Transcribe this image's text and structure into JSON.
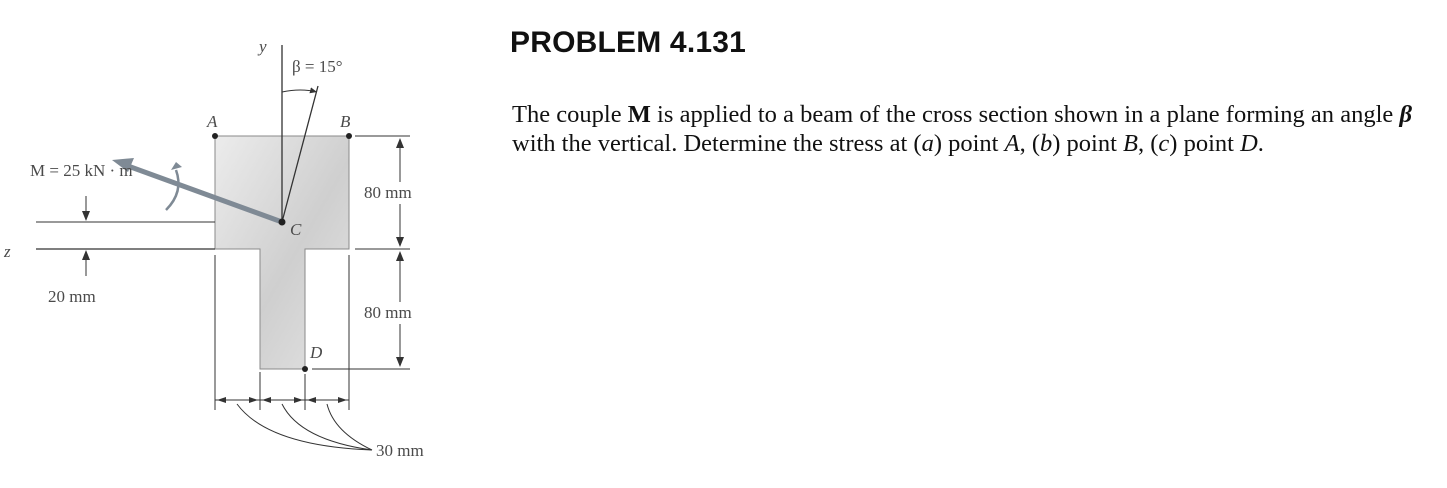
{
  "problem": {
    "title": "PROBLEM 4.131",
    "statement": {
      "p1": "The couple ",
      "M": "M",
      "p2": " is applied to a beam of the cross section shown in a plane forming an angle ",
      "beta": "β",
      "p3": " with the vertical. Determine the stress at (",
      "a": "a",
      "p4": ") point ",
      "A": "A",
      "p5": ", (",
      "b": "b",
      "p6": ") point ",
      "B": "B",
      "p7": ", (",
      "c": "c",
      "p8": ") point ",
      "D": "D",
      "p9": "."
    }
  },
  "figure": {
    "moment_label": "M = 25 kN · m",
    "beta_label": "β = 15°",
    "axis_y": "y",
    "axis_z": "z",
    "point_A": "A",
    "point_B": "B",
    "point_C": "C",
    "point_D": "D",
    "dim_80_top": "80 mm",
    "dim_80_bottom": "80 mm",
    "dim_20": "20 mm",
    "dim_30": "30 mm",
    "colors": {
      "section_fill": "#d4d4d4",
      "moment_arrow": "#7f8a95",
      "line": "#333333"
    }
  }
}
